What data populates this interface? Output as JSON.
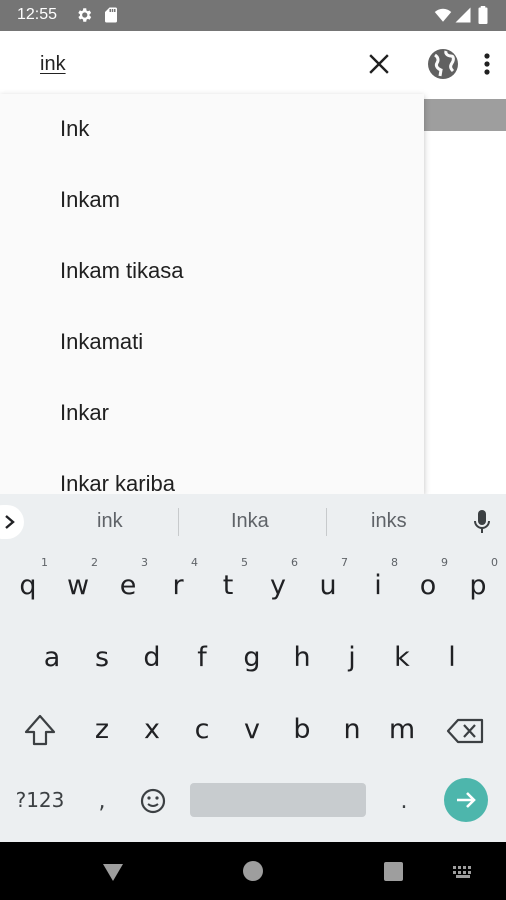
{
  "status_bar": {
    "time": "12:55",
    "icons": [
      "gear-icon",
      "sd-card-icon",
      "wifi-icon",
      "signal-icon",
      "battery-icon"
    ]
  },
  "search": {
    "query": "ink",
    "clear_icon": "close-icon",
    "globe_icon": "globe-icon",
    "menu_icon": "more-vert-icon"
  },
  "suggestions": [
    {
      "label": "Ink"
    },
    {
      "label": "Inkam"
    },
    {
      "label": "Inkam tikasa"
    },
    {
      "label": "Inkamati"
    },
    {
      "label": "Inkar"
    },
    {
      "label": "Inkar kariba"
    }
  ],
  "keyboard": {
    "suggestions": [
      "ink",
      "Inka",
      "inks"
    ],
    "row1": [
      {
        "ch": "q",
        "hint": "1"
      },
      {
        "ch": "w",
        "hint": "2"
      },
      {
        "ch": "e",
        "hint": "3"
      },
      {
        "ch": "r",
        "hint": "4"
      },
      {
        "ch": "t",
        "hint": "5"
      },
      {
        "ch": "y",
        "hint": "6"
      },
      {
        "ch": "u",
        "hint": "7"
      },
      {
        "ch": "i",
        "hint": "8"
      },
      {
        "ch": "o",
        "hint": "9"
      },
      {
        "ch": "p",
        "hint": "0"
      }
    ],
    "row2": [
      "a",
      "s",
      "d",
      "f",
      "g",
      "h",
      "j",
      "k",
      "l"
    ],
    "row3": [
      "z",
      "x",
      "c",
      "v",
      "b",
      "n",
      "m"
    ],
    "symbols_label": "?123",
    "comma": ",",
    "period": ".",
    "accent_color": "#4db6ac"
  },
  "nav_bar": {
    "icons": [
      "back-icon",
      "home-icon",
      "recents-icon",
      "keyboard-switch-icon"
    ]
  }
}
